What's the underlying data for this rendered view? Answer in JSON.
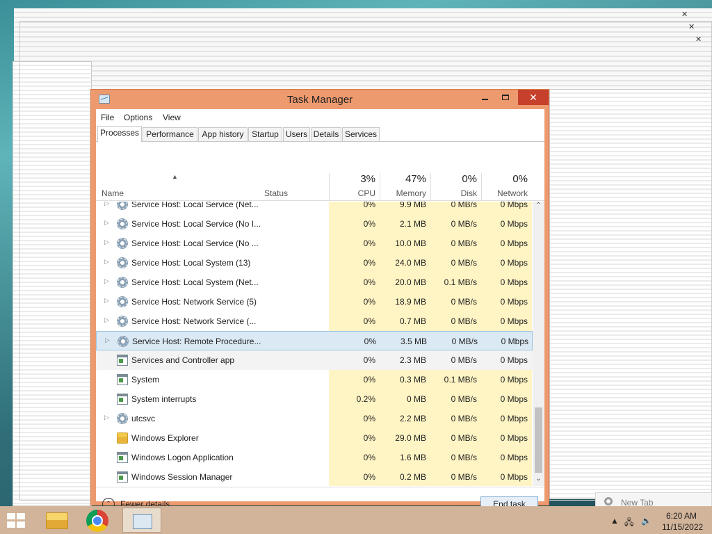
{
  "window": {
    "title": "Task Manager",
    "close_glyph": "✕"
  },
  "menu": [
    "File",
    "Options",
    "View"
  ],
  "tabs": [
    "Processes",
    "Performance",
    "App history",
    "Startup",
    "Users",
    "Details",
    "Services"
  ],
  "active_tab": "Processes",
  "columns": {
    "name": "Name",
    "status": "Status",
    "cpu": {
      "pct": "3%",
      "label": "CPU"
    },
    "memory": {
      "pct": "47%",
      "label": "Memory"
    },
    "disk": {
      "pct": "0%",
      "label": "Disk"
    },
    "network": {
      "pct": "0%",
      "label": "Network"
    }
  },
  "processes": [
    {
      "name": "Service Host: Local Service (Net...",
      "icon": "gear-icon",
      "expandable": true,
      "cpu": "0%",
      "memory": "9.9 MB",
      "disk": "0 MB/s",
      "network": "0 Mbps"
    },
    {
      "name": "Service Host: Local Service (No I...",
      "icon": "gear-icon",
      "expandable": true,
      "cpu": "0%",
      "memory": "2.1 MB",
      "disk": "0 MB/s",
      "network": "0 Mbps"
    },
    {
      "name": "Service Host: Local Service (No ...",
      "icon": "gear-icon",
      "expandable": true,
      "cpu": "0%",
      "memory": "10.0 MB",
      "disk": "0 MB/s",
      "network": "0 Mbps"
    },
    {
      "name": "Service Host: Local System (13)",
      "icon": "gear-icon",
      "expandable": true,
      "cpu": "0%",
      "memory": "24.0 MB",
      "disk": "0 MB/s",
      "network": "0 Mbps"
    },
    {
      "name": "Service Host: Local System (Net...",
      "icon": "gear-icon",
      "expandable": true,
      "cpu": "0%",
      "memory": "20.0 MB",
      "disk": "0.1 MB/s",
      "network": "0 Mbps"
    },
    {
      "name": "Service Host: Network Service (5)",
      "icon": "gear-icon",
      "expandable": true,
      "cpu": "0%",
      "memory": "18.9 MB",
      "disk": "0 MB/s",
      "network": "0 Mbps"
    },
    {
      "name": "Service Host: Network Service (...",
      "icon": "gear-icon",
      "expandable": true,
      "cpu": "0%",
      "memory": "0.7 MB",
      "disk": "0 MB/s",
      "network": "0 Mbps"
    },
    {
      "name": "Service Host: Remote Procedure...",
      "icon": "gear-icon",
      "expandable": true,
      "cpu": "0%",
      "memory": "3.5 MB",
      "disk": "0 MB/s",
      "network": "0 Mbps",
      "state": "selected"
    },
    {
      "name": "Services and Controller app",
      "icon": "window-app-icon",
      "expandable": false,
      "cpu": "0%",
      "memory": "2.3 MB",
      "disk": "0 MB/s",
      "network": "0 Mbps",
      "state": "light"
    },
    {
      "name": "System",
      "icon": "window-app-icon",
      "expandable": false,
      "cpu": "0%",
      "memory": "0.3 MB",
      "disk": "0.1 MB/s",
      "network": "0 Mbps"
    },
    {
      "name": "System interrupts",
      "icon": "window-app-icon",
      "expandable": false,
      "cpu": "0.2%",
      "memory": "0 MB",
      "disk": "0 MB/s",
      "network": "0 Mbps"
    },
    {
      "name": "utcsvc",
      "icon": "gear-icon",
      "expandable": true,
      "cpu": "0%",
      "memory": "2.2 MB",
      "disk": "0 MB/s",
      "network": "0 Mbps"
    },
    {
      "name": "Windows Explorer",
      "icon": "folder-icon",
      "expandable": false,
      "cpu": "0%",
      "memory": "29.0 MB",
      "disk": "0 MB/s",
      "network": "0 Mbps"
    },
    {
      "name": "Windows Logon Application",
      "icon": "window-app-icon",
      "expandable": false,
      "cpu": "0%",
      "memory": "1.6 MB",
      "disk": "0 MB/s",
      "network": "0 Mbps"
    },
    {
      "name": "Windows Session Manager",
      "icon": "window-app-icon",
      "expandable": false,
      "cpu": "0%",
      "memory": "0.2 MB",
      "disk": "0 MB/s",
      "network": "0 Mbps"
    }
  ],
  "footer": {
    "fewer_details": "Fewer details",
    "end_task": "End task"
  },
  "taskbar": {
    "clock_time": "6:20 AM",
    "clock_date": "11/15/2022",
    "new_tab": "New Tab"
  },
  "colors": {
    "window_frame": "#ee9a6f",
    "close_button": "#c7402b",
    "heat": "#fff4c4",
    "taskbar": "#d2b49a"
  }
}
